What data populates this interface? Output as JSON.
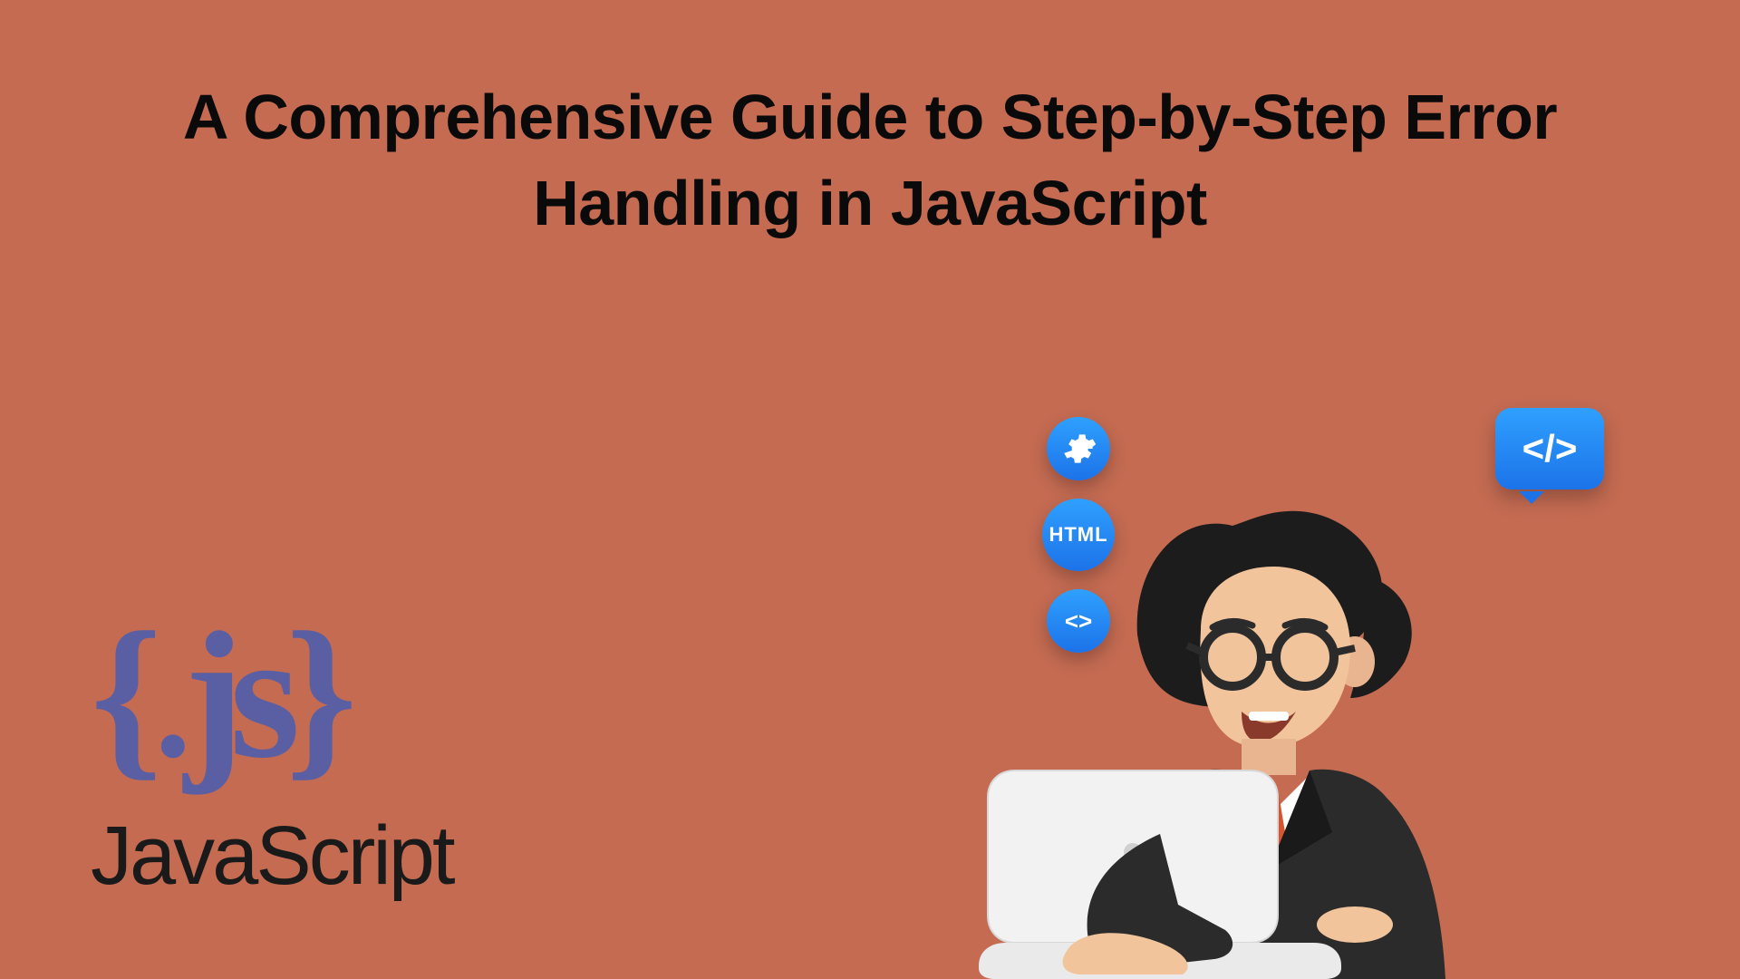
{
  "title": "A Comprehensive Guide to Step-by-Step Error Handling in JavaScript",
  "logo": {
    "braces": "{.js}",
    "label": "JavaScript"
  },
  "badges": {
    "html": "HTML",
    "code_bracket": "<>",
    "speech_code": "</>"
  },
  "colors": {
    "background": "#C46B52",
    "logo_purple": "#5a5fa3",
    "title_black": "#0a0a0a",
    "badge_blue": "#1c73e8"
  }
}
